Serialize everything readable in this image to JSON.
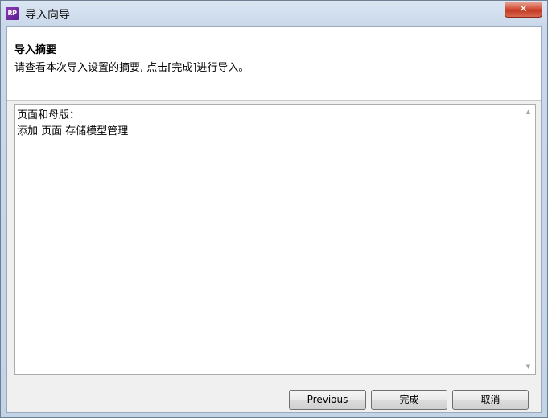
{
  "window": {
    "title": "导入向导",
    "icon": "rp-app-icon",
    "icon_text": "RP",
    "close_label": "✕"
  },
  "header": {
    "title": "导入摘要",
    "description": "请查看本次导入设置的摘要, 点击[完成]进行导入。"
  },
  "summary": {
    "lines": [
      "页面和母版：",
      "添加 页面 存储模型管理"
    ]
  },
  "scrollbar": {
    "up_arrow": "▲",
    "down_arrow": "▼"
  },
  "buttons": {
    "previous": "Previous",
    "finish": "完成",
    "cancel": "取消"
  },
  "colors": {
    "close_button": "#c9412a",
    "app_icon": "#7a2fa8"
  }
}
